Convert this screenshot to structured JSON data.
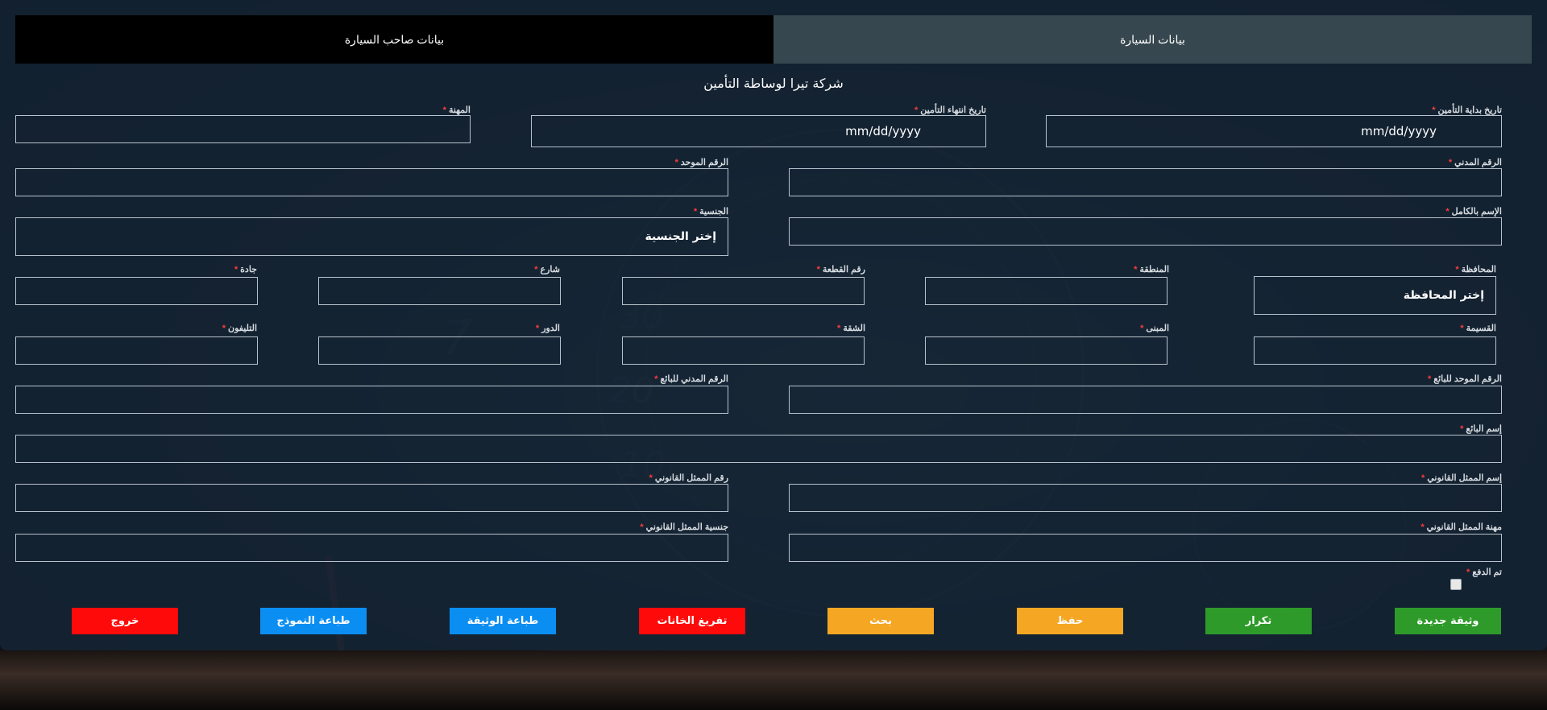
{
  "tabs": {
    "owner": "بيانات صاحب السيارة",
    "car": "بيانات السيارة"
  },
  "title": "شركة تيرا لوساطة التأمين",
  "required_mark": "*",
  "fields": {
    "insurance_start": {
      "label": "تاريخ بداية التأمين",
      "value": "mm/dd/yyyy"
    },
    "insurance_end": {
      "label": "تاريخ انتهاء التأمين",
      "value": "mm/dd/yyyy"
    },
    "profession": {
      "label": "المهنة",
      "value": ""
    },
    "civil_id": {
      "label": "الرقم المدني",
      "value": ""
    },
    "unified_number": {
      "label": "الرقم الموحد",
      "value": ""
    },
    "full_name": {
      "label": "الإسم بالكامل",
      "value": ""
    },
    "nationality": {
      "label": "الجنسية",
      "value": "إختر الجنسية"
    },
    "governorate": {
      "label": "المحافظة",
      "value": "إختر المحافظة"
    },
    "area": {
      "label": "المنطقة",
      "value": ""
    },
    "block": {
      "label": "رقم القطعة",
      "value": ""
    },
    "street": {
      "label": "شارع",
      "value": ""
    },
    "avenue": {
      "label": "جادة",
      "value": ""
    },
    "plot": {
      "label": "القسيمة",
      "value": ""
    },
    "building": {
      "label": "المبنى",
      "value": ""
    },
    "apartment": {
      "label": "الشقة",
      "value": ""
    },
    "floor": {
      "label": "الدور",
      "value": ""
    },
    "phone": {
      "label": "التليفون",
      "value": ""
    },
    "seller_unified": {
      "label": "الرقم الموحد للبائع",
      "value": ""
    },
    "seller_civil": {
      "label": "الرقم المدني للبائع",
      "value": ""
    },
    "seller_name": {
      "label": "إسم البائع",
      "value": ""
    },
    "legal_rep_name": {
      "label": "إسم الممثل القانوني",
      "value": ""
    },
    "legal_rep_number": {
      "label": "رقم الممثل القانوني",
      "value": ""
    },
    "legal_rep_profession": {
      "label": "مهنة الممثل القانوني",
      "value": ""
    },
    "legal_rep_nationality": {
      "label": "جنسية الممثل القانوني",
      "value": ""
    },
    "paid": {
      "label": "تم الدفع",
      "checked": false
    }
  },
  "buttons": {
    "new_policy": "وثيقة جديدة",
    "repeat": "تكرار",
    "save": "حفظ",
    "search": "بحث",
    "clear_fields": "تفريغ الخانات",
    "print_policy": "طباعة الوثيقة",
    "print_form": "طباعة النموذج",
    "exit": "خروج"
  },
  "colors": {
    "green": "#2e9a2a",
    "yellow": "#f5a623",
    "red": "#fe0a0a",
    "blue": "#0b8ef2",
    "required": "#ff3b3b"
  },
  "background_numerals": [
    "7",
    "30",
    "20",
    "10"
  ]
}
